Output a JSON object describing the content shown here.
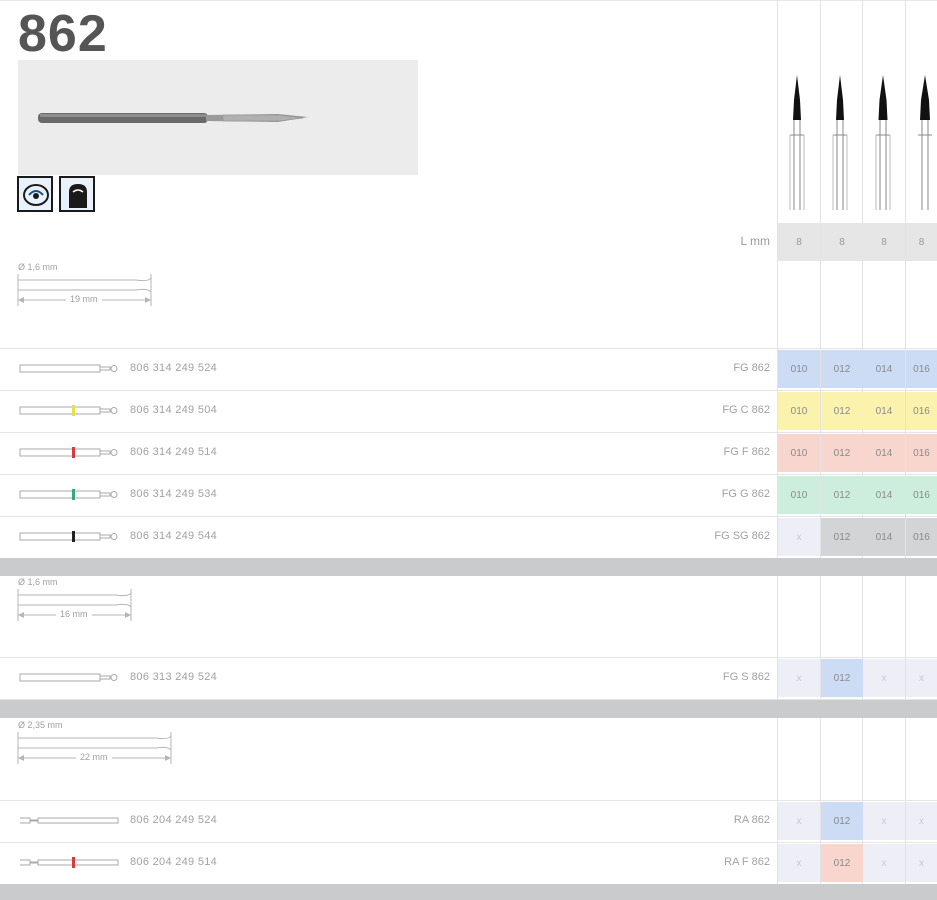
{
  "product": {
    "title": "862",
    "length_label": "L mm",
    "lengths": [
      "8",
      "8",
      "8",
      "8"
    ]
  },
  "icons": [
    "speed-icon",
    "tooth-icon"
  ],
  "sections": [
    {
      "dimension": {
        "diameter": "Ø 1,6 mm",
        "length": "19 mm"
      },
      "rows": [
        {
          "ref": "806 314 249 524",
          "code": "FG 862",
          "stripe": "",
          "cells": [
            "010",
            "012",
            "014",
            "016"
          ],
          "color": "#cddcf5"
        },
        {
          "ref": "806 314 249 504",
          "code": "FG C 862",
          "stripe": "#e6e04a",
          "cells": [
            "010",
            "012",
            "014",
            "016"
          ],
          "color": "#faf2ad"
        },
        {
          "ref": "806 314 249 514",
          "code": "FG F 862",
          "stripe": "#d93a3a",
          "cells": [
            "010",
            "012",
            "014",
            "016"
          ],
          "color": "#f8d6cd"
        },
        {
          "ref": "806 314 249 534",
          "code": "FG G 862",
          "stripe": "#3aa878",
          "cells": [
            "010",
            "012",
            "014",
            "016"
          ],
          "color": "#cdeedd"
        },
        {
          "ref": "806 314 249 544",
          "code": "FG SG 862",
          "stripe": "#222222",
          "cells": [
            "x",
            "012",
            "014",
            "016"
          ],
          "color": "#d3d4d6"
        }
      ]
    },
    {
      "dimension": {
        "diameter": "Ø 1,6 mm",
        "length": "16 mm"
      },
      "rows": [
        {
          "ref": "806 313 249 524",
          "code": "FG S 862",
          "stripe": "",
          "cells": [
            "x",
            "012",
            "x",
            "x"
          ],
          "color": "#cddcf5"
        }
      ]
    },
    {
      "dimension": {
        "diameter": "Ø 2,35 mm",
        "length": "22 mm"
      },
      "rows": [
        {
          "ref": "806 204 249 524",
          "code": "RA 862",
          "stripe": "",
          "cells": [
            "x",
            "012",
            "x",
            "x"
          ],
          "color": "#cddcf5"
        },
        {
          "ref": "806 204 249 514",
          "code": "RA F 862",
          "stripe": "#d93a3a",
          "cells": [
            "x",
            "012",
            "x",
            "x"
          ],
          "color": "#f8d6cd"
        }
      ]
    }
  ]
}
